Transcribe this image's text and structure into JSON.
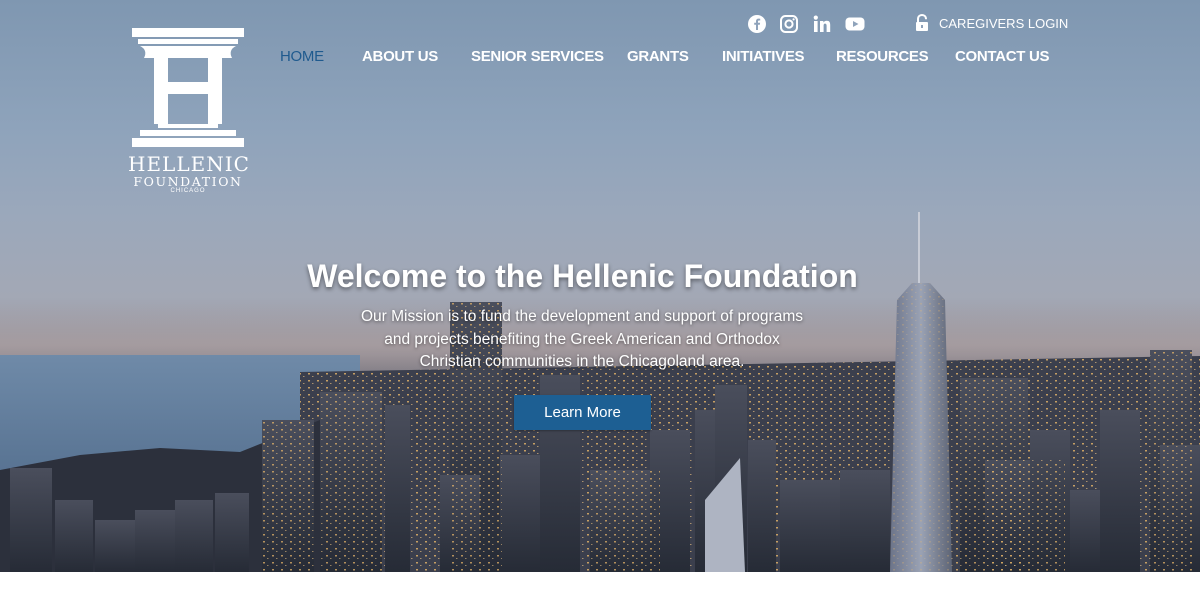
{
  "logo": {
    "line1": "HELLENIC",
    "line2": "FOUNDATION",
    "line3": "CHICAGO"
  },
  "social": [
    "facebook-icon",
    "instagram-icon",
    "linkedin-icon",
    "youtube-icon"
  ],
  "login": {
    "icon": "lock-icon",
    "label": "CAREGIVERS LOGIN"
  },
  "nav": [
    {
      "label": "HOME",
      "active": true
    },
    {
      "label": "ABOUT US",
      "active": false
    },
    {
      "label": "SENIOR SERVICES",
      "active": false
    },
    {
      "label": "GRANTS",
      "active": false
    },
    {
      "label": "INITIATIVES",
      "active": false
    },
    {
      "label": "RESOURCES",
      "active": false
    },
    {
      "label": "CONTACT US",
      "active": false
    }
  ],
  "hero": {
    "title": "Welcome to the Hellenic Foundation",
    "mission_line1": "Our Mission is to fund the development and support of programs",
    "mission_line2": "and projects benefiting the Greek American and Orthodox",
    "mission_line3": "Christian communities in the Chicagoland area.",
    "button": "Learn More"
  },
  "colors": {
    "accent": "#1d5f93",
    "nav_active": "#1f5a8e"
  }
}
